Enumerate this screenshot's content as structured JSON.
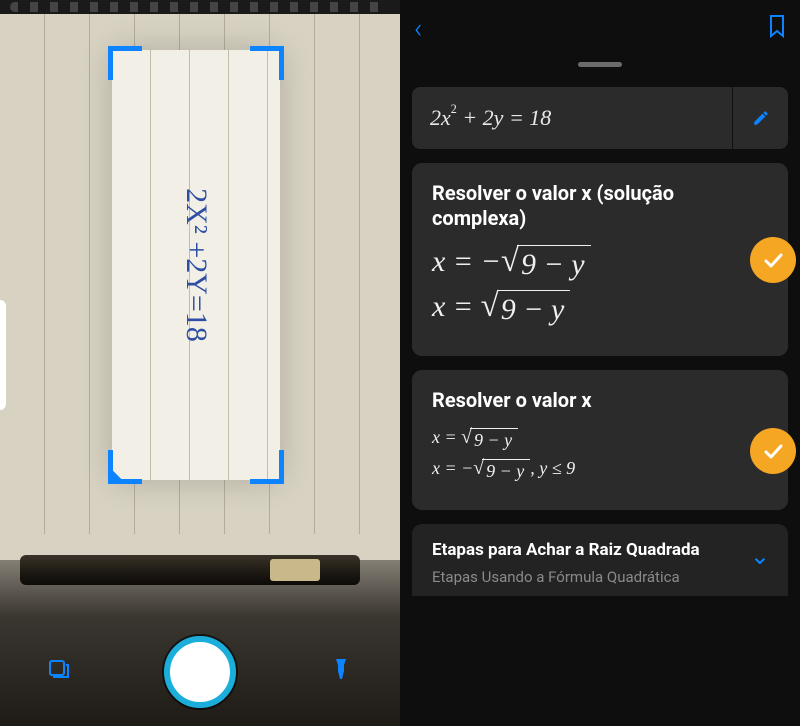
{
  "colors": {
    "accent": "#0d84ff",
    "warn_badge": "#f5a623"
  },
  "camera": {
    "handwriting": "2X² +2Y=18",
    "gallery_icon": "gallery",
    "shutter": "capture",
    "flash_icon": "flashlight"
  },
  "solver": {
    "equation": "2x² + 2y = 18",
    "edit_icon": "pencil",
    "cards": [
      {
        "title": "Resolver o valor x (solução complexa)",
        "lines": [
          {
            "lhs": "x",
            "op": "=",
            "neg": true,
            "radicand": "9 − y"
          },
          {
            "lhs": "x",
            "op": "=",
            "neg": false,
            "radicand": "9 − y"
          }
        ],
        "size": "big"
      },
      {
        "title": "Resolver o valor x",
        "lines": [
          {
            "lhs": "x",
            "op": "=",
            "neg": false,
            "radicand": "9 − y",
            "suffix": ""
          },
          {
            "lhs": "x",
            "op": "=",
            "neg": true,
            "radicand": "9 − y",
            "suffix": ",  y ≤ 9"
          }
        ],
        "size": "small"
      }
    ],
    "steps": {
      "title": "Etapas para Achar a Raiz Quadrada",
      "subtitle": "Etapas Usando a Fórmula Quadrática"
    }
  }
}
